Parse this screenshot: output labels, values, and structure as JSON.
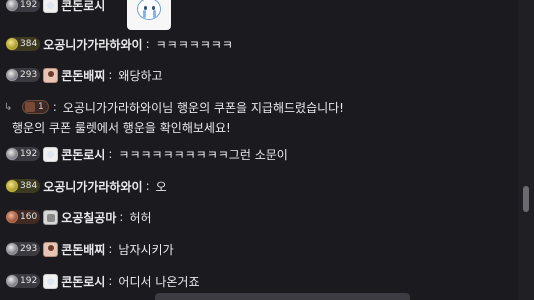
{
  "chat": {
    "messages": [
      {
        "badge": "192",
        "badge_style": "silver",
        "avatar": "ghost",
        "nick": "콘돈로시",
        "text": ""
      },
      {
        "badge": "384",
        "badge_style": "gold",
        "avatar": "none",
        "nick": "오공니가가라하와이",
        "text": "ㅋㅋㅋㅋㅋㅋㅋ"
      },
      {
        "badge": "293",
        "badge_style": "silver",
        "avatar": "person",
        "nick": "콘돈배찌",
        "text": "왜당하고"
      },
      {
        "badge": "192",
        "badge_style": "silver",
        "avatar": "ghost",
        "nick": "콘돈로시",
        "text": "ㅋㅋㅋㅋㅋㅋㅋㅋㅋㅋ그런 소문이"
      },
      {
        "badge": "384",
        "badge_style": "gold",
        "avatar": "none",
        "nick": "오공니가가라하와이",
        "text": "오"
      },
      {
        "badge": "160",
        "badge_style": "copper",
        "avatar": "knight",
        "nick": "오공칠공마",
        "text": "허허"
      },
      {
        "badge": "293",
        "badge_style": "silver",
        "avatar": "person",
        "nick": "콘돈배찌",
        "text": "남자시키가"
      },
      {
        "badge": "192",
        "badge_style": "silver",
        "avatar": "ghost",
        "nick": "콘돈로시",
        "text": "어디서 나온거죠"
      }
    ],
    "colon": ":",
    "system": {
      "badge": "1",
      "line1": "오공니가가라하와이님 행운의 쿠폰을 지급해드렸습니다!",
      "line2": "행운의 쿠폰 룰렛에서 행운을 확인해보세요!"
    }
  },
  "icons": {
    "emote": "crying-ghost-emote-icon",
    "badge_gem": "level-gem-icon",
    "reply_arrow": "reply-arrow-icon"
  },
  "colors": {
    "background": "#1b1b1f",
    "text": "#e9e9ec",
    "gold_badge": "#c9b741",
    "copper_badge": "#c27655"
  }
}
